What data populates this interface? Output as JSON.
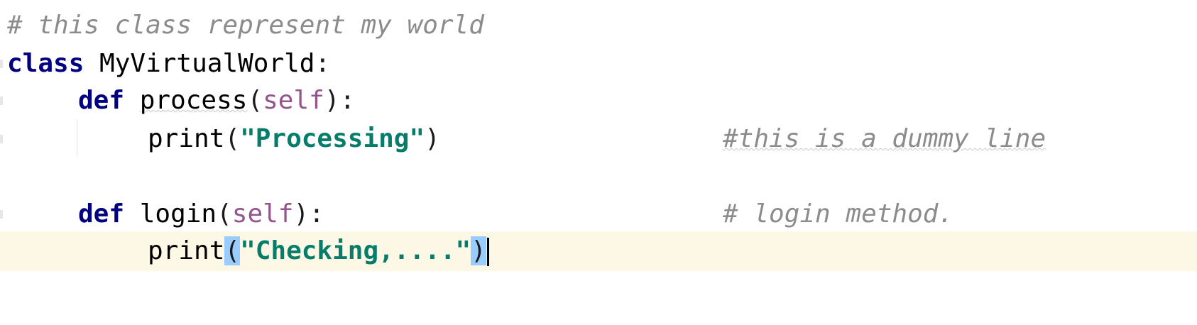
{
  "editor": {
    "language": "python",
    "colors": {
      "keyword": "#000080",
      "string": "#067d6b",
      "comment": "#8c8c8c",
      "self": "#94558d",
      "current_line": "#fdf8e6",
      "brace_match": "#99ccff"
    },
    "lines": {
      "l1": {
        "comment": "# this class represent my world"
      },
      "l2": {
        "kw": "class",
        "name": " MyVirtualWorld",
        "punct": ":"
      },
      "l3": {
        "kw": "def",
        "fn": "process",
        "open": "(",
        "self": "self",
        "close": "):"
      },
      "l4": {
        "fn": "print",
        "open": "(",
        "str": "\"Processing\"",
        "close": ")",
        "comment": "#this is a dummy line"
      },
      "l6": {
        "kw": "def",
        "fn": "login",
        "open": "(",
        "self": "self",
        "close": "):",
        "comment": "# login method."
      },
      "l7": {
        "fn": "print",
        "open": "(",
        "str": "\"Checking,....\"",
        "close": ")"
      }
    }
  }
}
